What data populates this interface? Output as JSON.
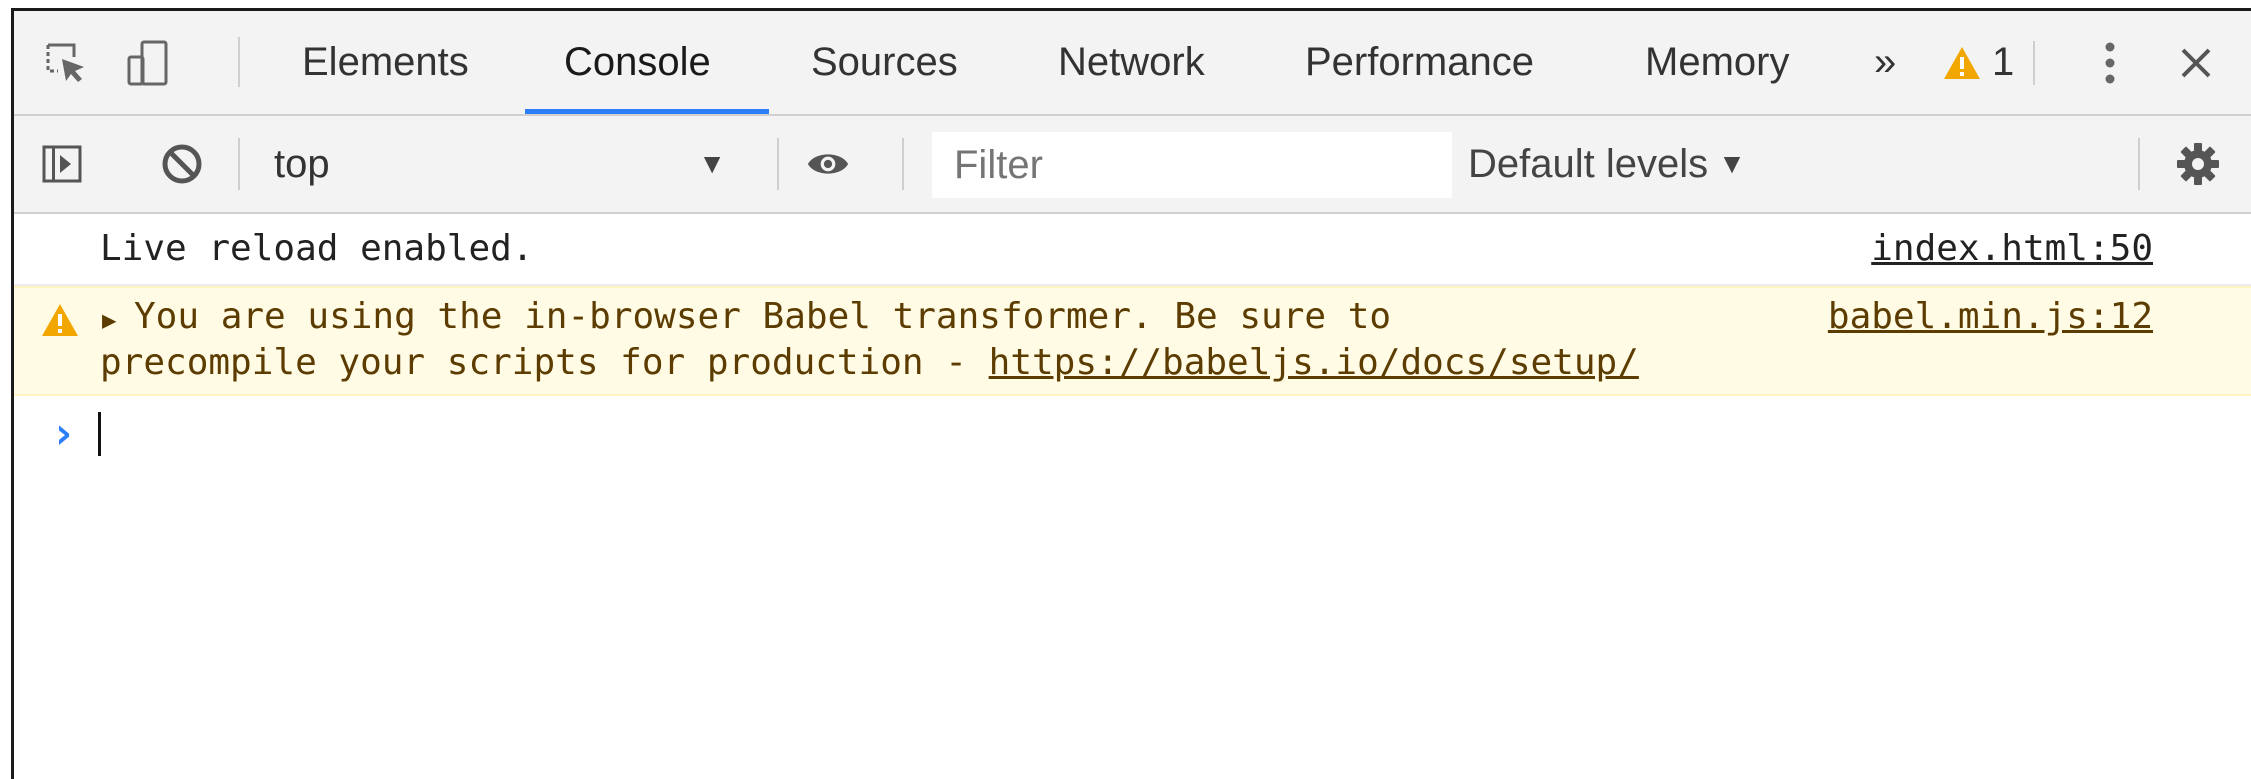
{
  "tabbar": {
    "tabs": [
      {
        "label": "Elements"
      },
      {
        "label": "Console"
      },
      {
        "label": "Sources"
      },
      {
        "label": "Network"
      },
      {
        "label": "Performance"
      },
      {
        "label": "Memory"
      }
    ],
    "active_tab": "Console",
    "more_label": "»",
    "warning_count": "1"
  },
  "toolbar": {
    "context": "top",
    "filter_placeholder": "Filter",
    "filter_value": "",
    "levels_label": "Default levels",
    "levels_arrow": "▼"
  },
  "console": {
    "messages": [
      {
        "level": "log",
        "text": "Live reload enabled.",
        "source": "index.html:50"
      },
      {
        "level": "warning",
        "line1": "You are using the in-browser Babel transformer. Be sure to",
        "line2": "precompile your scripts for production - ",
        "link": "https://babeljs.io/docs/setup/",
        "source": "babel.min.js:12"
      }
    ],
    "prompt_symbol": "›"
  },
  "colors": {
    "accent": "#2d7ff9",
    "warning_bg": "#fffbe5",
    "warning_icon": "#f2a600",
    "warning_text": "#5c3c00"
  },
  "icons": [
    "inspect-element-icon",
    "device-toolbar-icon",
    "warning-icon",
    "kebab-menu-icon",
    "close-icon",
    "sidebar-toggle-icon",
    "clear-console-icon",
    "eye-icon",
    "gear-icon"
  ]
}
